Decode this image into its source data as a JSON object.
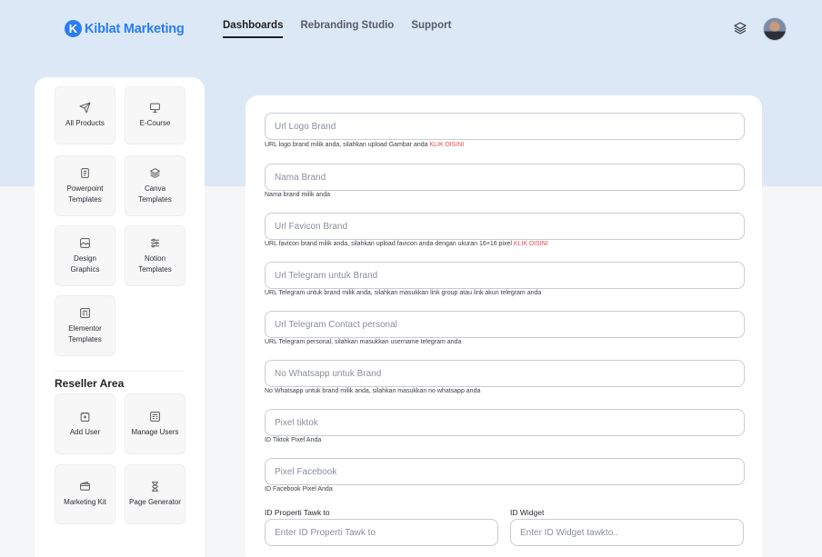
{
  "brand": {
    "mark": "K",
    "name": "Kiblat Marketing",
    "accent": "#2a7cf0"
  },
  "nav": {
    "items": [
      {
        "label": "Dashboards",
        "active": true
      },
      {
        "label": "Rebranding Studio",
        "active": false
      },
      {
        "label": "Support",
        "active": false
      }
    ]
  },
  "header_icons": {
    "layers": "layers-icon",
    "avatar": "user-avatar"
  },
  "sidebar": {
    "tiles": [
      {
        "label": "All Products",
        "icon": "paper-plane-icon"
      },
      {
        "label": "E-Course",
        "icon": "monitor-icon"
      },
      {
        "label": "Powerpoint Templates",
        "icon": "document-icon"
      },
      {
        "label": "Canva Templates",
        "icon": "layers-icon"
      },
      {
        "label": "Design Graphics",
        "icon": "image-icon"
      },
      {
        "label": "Notion Templates",
        "icon": "sliders-icon"
      },
      {
        "label": "Elementor Templates",
        "icon": "template-icon"
      }
    ],
    "reseller_title": "Reseller Area",
    "reseller_tiles": [
      {
        "label": "Add User",
        "icon": "add-user-icon"
      },
      {
        "label": "Manage Users",
        "icon": "manage-users-icon"
      },
      {
        "label": "Marketing Kit",
        "icon": "wallet-icon"
      },
      {
        "label": "Page Generator",
        "icon": "hourglass-icon"
      }
    ]
  },
  "form": {
    "fields": [
      {
        "placeholder": "Url Logo Brand",
        "help": "URL logo brand milik anda, silahkan upload Gambar anda ",
        "link": "KLIK DISINI"
      },
      {
        "placeholder": "Nama Brand",
        "help": "Nama brand milik anda",
        "link": ""
      },
      {
        "placeholder": "Url Favicon Brand",
        "help": "URL favicon brand milik anda, silahkan upload favicon anda dengan ukuran 16×16 pixel ",
        "link": "KLIK DISINI"
      },
      {
        "placeholder": "Url Telegram untuk Brand",
        "help": "URL Telegram untuk brand milik anda, silahkan masukkan link group atau link akun telegram anda",
        "link": ""
      },
      {
        "placeholder": "Url Telegram Contact personal",
        "help": "URL Telegram personal, silahkan masukkan username telegram anda",
        "link": ""
      },
      {
        "placeholder": "No Whatsapp untuk Brand",
        "help": "No Whatsapp untuk brand milik anda, silahkan masukkan no whatsapp anda",
        "link": ""
      },
      {
        "placeholder": "Pixel tiktok",
        "help": "ID Tiktok Pixel Anda",
        "link": ""
      },
      {
        "placeholder": "Pixel Facebook",
        "help": "ID Facebook Pixel Anda",
        "link": ""
      }
    ],
    "tawk": {
      "label": "ID Properti Tawk to",
      "placeholder": "Enter ID Properti Tawk to"
    },
    "widget": {
      "label": "ID Widget",
      "placeholder": "Enter ID Widget tawkto.."
    },
    "link_color": "#e14b4b"
  }
}
